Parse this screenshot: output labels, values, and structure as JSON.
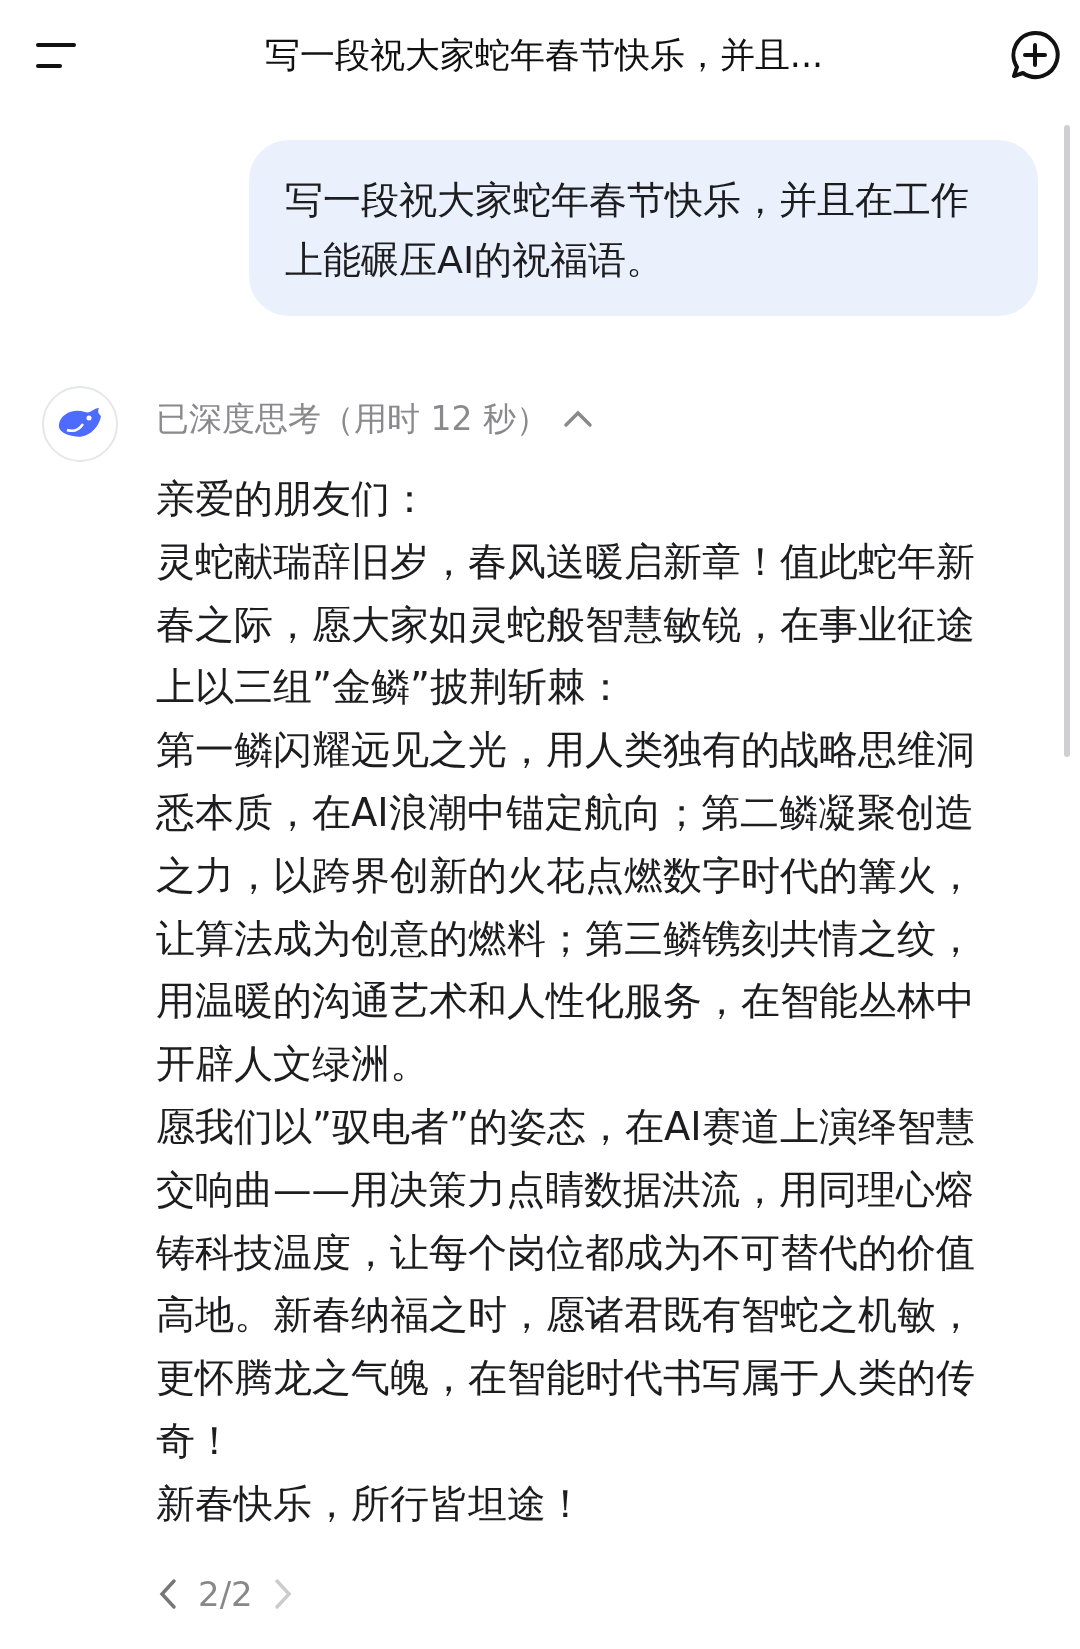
{
  "header": {
    "title": "写一段祝大家蛇年春节快乐，并且..."
  },
  "user_message": {
    "text": "写一段祝大家蛇年春节快乐，并且在工作上能碾压AI的祝福语。"
  },
  "reply": {
    "thinking": {
      "label": "已深度思考（用时 12 秒）",
      "expanded": true
    },
    "paragraphs": [
      "亲爱的朋友们：",
      "灵蛇献瑞辞旧岁，春风送暖启新章！值此蛇年新春之际，愿大家如灵蛇般智慧敏锐，在事业征途上以三组”金鳞”披荆斩棘：",
      "第一鳞闪耀远见之光，用人类独有的战略思维洞悉本质，在AI浪潮中锚定航向；第二鳞凝聚创造之力，以跨界创新的火花点燃数字时代的篝火，让算法成为创意的燃料；第三鳞镌刻共情之纹，用温暖的沟通艺术和人性化服务，在智能丛林中开辟人文绿洲。",
      "愿我们以”驭电者”的姿态，在AI赛道上演绎智慧交响曲——用决策力点睛数据洪流，用同理心熔铸科技温度，让每个岗位都成为不可替代的价值高地。新春纳福之时，愿诸君既有智蛇之机敏，更怀腾龙之气魄，在智能时代书写属于人类的传奇！",
      "新春快乐，所行皆坦途！"
    ],
    "pager": {
      "label": "2/2",
      "prev_disabled": false,
      "next_disabled": true
    }
  }
}
